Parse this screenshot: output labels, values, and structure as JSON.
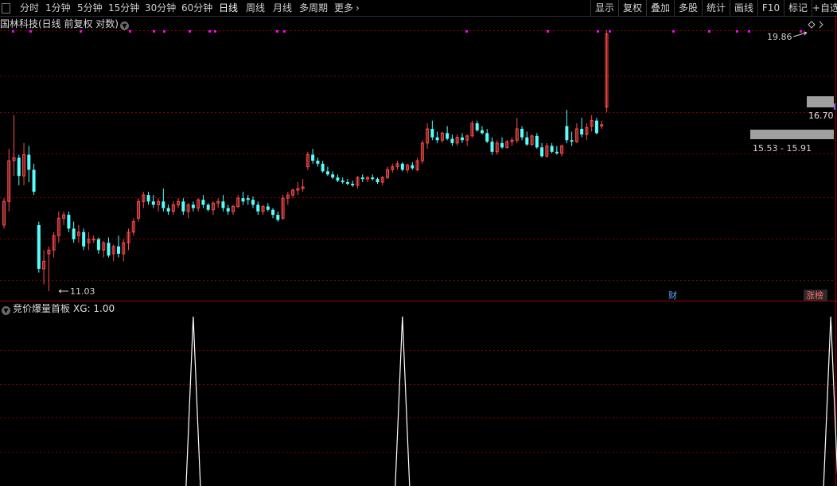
{
  "toolbar": {
    "left_buttons": [
      "分时",
      "1分钟",
      "5分钟",
      "15分钟",
      "30分钟",
      "60分钟",
      "日线",
      "周线",
      "月线",
      "多周期",
      "更多"
    ],
    "active_button": "日线",
    "right_buttons": [
      "显示",
      "复权",
      "叠加",
      "多股",
      "统计",
      "画线",
      "F10",
      "标记",
      "+自选"
    ]
  },
  "chart": {
    "title": "国林科技(日线 前复权 对数)",
    "high_label": "19.86",
    "low_label": "11.03",
    "current_price_label": "16.70",
    "range_label": "15.53 - 15.91",
    "badge_finance": "财",
    "badge_rank": "涨榜"
  },
  "indicator": {
    "title": "竞价爆量首板",
    "value_label": "XG: 1.00"
  },
  "colors": {
    "up": "#ff4a4a",
    "down": "#54ffff",
    "grid": "#8a0000",
    "marker": "#ff00ff",
    "signal": "#ffffff"
  },
  "chart_data": {
    "type": "candlestick",
    "title": "国林科技(日线 前复权 对数)",
    "y_labels": [
      "19.86",
      "16.70",
      "15.53 - 15.91",
      "11.03"
    ],
    "indicator_series": {
      "name": "XG",
      "signal_bars": [
        38,
        80,
        166
      ],
      "value": 1.0
    },
    "candles": [
      [
        12.8,
        13.6,
        12.7,
        13.5
      ],
      [
        13.5,
        15.2,
        13.2,
        14.8
      ],
      [
        14.8,
        16.4,
        14.3,
        14.9
      ],
      [
        14.9,
        15.0,
        14.0,
        14.3
      ],
      [
        14.3,
        15.4,
        14.0,
        15.0
      ],
      [
        15.0,
        15.3,
        14.1,
        14.5
      ],
      [
        14.5,
        14.7,
        13.7,
        13.8
      ],
      [
        12.8,
        12.9,
        11.5,
        11.6
      ],
      [
        11.6,
        12.1,
        11.2,
        11.8
      ],
      [
        12.0,
        12.2,
        11.03,
        12.1
      ],
      [
        12.1,
        12.6,
        11.9,
        12.5
      ],
      [
        12.5,
        13.2,
        12.3,
        13.0
      ],
      [
        13.0,
        13.2,
        12.8,
        13.1
      ],
      [
        13.1,
        13.2,
        12.6,
        12.7
      ],
      [
        12.7,
        12.9,
        12.3,
        12.4
      ],
      [
        12.5,
        12.8,
        12.3,
        12.6
      ],
      [
        12.6,
        12.7,
        12.1,
        12.2
      ],
      [
        12.3,
        12.6,
        12.1,
        12.4
      ],
      [
        12.4,
        12.5,
        12.3,
        12.4
      ],
      [
        12.4,
        12.45,
        12.0,
        12.1
      ],
      [
        12.1,
        12.35,
        11.9,
        12.3
      ],
      [
        12.3,
        12.45,
        11.9,
        11.95
      ],
      [
        12.0,
        12.25,
        11.8,
        12.2
      ],
      [
        12.2,
        12.5,
        11.9,
        12.0
      ],
      [
        12.0,
        12.4,
        11.8,
        12.3
      ],
      [
        12.3,
        12.7,
        12.1,
        12.6
      ],
      [
        12.6,
        13.0,
        12.5,
        12.9
      ],
      [
        13.0,
        13.6,
        12.9,
        13.5
      ],
      [
        13.5,
        13.8,
        13.3,
        13.7
      ],
      [
        13.7,
        13.8,
        13.4,
        13.5
      ],
      [
        13.5,
        13.7,
        13.3,
        13.4
      ],
      [
        13.4,
        13.6,
        13.2,
        13.5
      ],
      [
        13.5,
        13.9,
        13.2,
        13.3
      ],
      [
        13.3,
        13.4,
        13.1,
        13.2
      ],
      [
        13.2,
        13.5,
        13.1,
        13.4
      ],
      [
        13.4,
        13.6,
        13.3,
        13.5
      ],
      [
        13.5,
        13.6,
        13.1,
        13.2
      ],
      [
        13.2,
        13.45,
        13.0,
        13.4
      ],
      [
        13.4,
        13.5,
        13.2,
        13.3
      ],
      [
        13.3,
        13.6,
        13.2,
        13.55
      ],
      [
        13.55,
        13.7,
        13.3,
        13.4
      ],
      [
        13.4,
        13.45,
        13.2,
        13.25
      ],
      [
        13.25,
        13.5,
        13.1,
        13.45
      ],
      [
        13.45,
        13.6,
        13.3,
        13.5
      ],
      [
        13.5,
        13.7,
        13.2,
        13.3
      ],
      [
        13.3,
        13.4,
        13.1,
        13.2
      ],
      [
        13.2,
        13.4,
        13.1,
        13.35
      ],
      [
        13.35,
        13.7,
        13.3,
        13.6
      ],
      [
        13.6,
        13.8,
        13.4,
        13.5
      ],
      [
        13.6,
        13.7,
        13.4,
        13.55
      ],
      [
        13.55,
        13.65,
        13.3,
        13.4
      ],
      [
        13.4,
        13.5,
        13.1,
        13.2
      ],
      [
        13.2,
        13.4,
        13.1,
        13.35
      ],
      [
        13.35,
        13.45,
        13.2,
        13.25
      ],
      [
        13.25,
        13.3,
        13.0,
        13.1
      ],
      [
        13.1,
        13.2,
        12.9,
        12.95
      ],
      [
        13.0,
        13.7,
        12.95,
        13.6
      ],
      [
        13.6,
        13.8,
        13.4,
        13.7
      ],
      [
        13.7,
        13.9,
        13.6,
        13.85
      ],
      [
        13.85,
        14.1,
        13.7,
        13.9
      ],
      [
        13.9,
        14.2,
        13.8,
        13.95
      ],
      [
        14.6,
        15.1,
        14.5,
        15.0
      ],
      [
        15.0,
        15.2,
        14.7,
        14.8
      ],
      [
        14.8,
        14.9,
        14.6,
        14.7
      ],
      [
        14.7,
        14.8,
        14.4,
        14.45
      ],
      [
        14.45,
        14.6,
        14.3,
        14.35
      ],
      [
        14.35,
        14.45,
        14.2,
        14.25
      ],
      [
        14.25,
        14.35,
        14.1,
        14.15
      ],
      [
        14.15,
        14.25,
        14.05,
        14.1
      ],
      [
        14.1,
        14.2,
        14.0,
        14.05
      ],
      [
        14.05,
        14.15,
        13.95,
        14.0
      ],
      [
        14.0,
        14.3,
        13.9,
        14.25
      ],
      [
        14.25,
        14.35,
        14.1,
        14.2
      ],
      [
        14.2,
        14.3,
        14.1,
        14.25
      ],
      [
        14.25,
        14.35,
        14.15,
        14.2
      ],
      [
        14.2,
        14.25,
        14.05,
        14.1
      ],
      [
        14.1,
        14.3,
        14.0,
        14.25
      ],
      [
        14.25,
        14.6,
        14.2,
        14.5
      ],
      [
        14.5,
        14.7,
        14.4,
        14.6
      ],
      [
        14.6,
        14.8,
        14.5,
        14.7
      ],
      [
        14.7,
        14.75,
        14.45,
        14.5
      ],
      [
        14.5,
        14.7,
        14.4,
        14.65
      ],
      [
        14.65,
        14.75,
        14.5,
        14.55
      ],
      [
        14.5,
        14.9,
        14.45,
        14.8
      ],
      [
        14.8,
        15.5,
        14.7,
        15.4
      ],
      [
        15.4,
        16.1,
        15.2,
        15.9
      ],
      [
        15.9,
        16.2,
        15.5,
        15.6
      ],
      [
        15.6,
        15.8,
        15.4,
        15.5
      ],
      [
        15.5,
        15.8,
        15.4,
        15.75
      ],
      [
        15.75,
        16.0,
        15.5,
        15.55
      ],
      [
        15.55,
        15.7,
        15.3,
        15.4
      ],
      [
        15.4,
        15.7,
        15.3,
        15.6
      ],
      [
        15.6,
        15.75,
        15.4,
        15.5
      ],
      [
        15.5,
        15.7,
        15.3,
        15.65
      ],
      [
        15.65,
        16.2,
        15.6,
        16.1
      ],
      [
        16.1,
        16.2,
        15.8,
        15.85
      ],
      [
        15.85,
        16.0,
        15.7,
        15.75
      ],
      [
        15.75,
        15.9,
        15.4,
        15.45
      ],
      [
        15.45,
        15.6,
        15.0,
        15.1
      ],
      [
        15.1,
        15.5,
        15.0,
        15.4
      ],
      [
        15.4,
        15.6,
        15.2,
        15.25
      ],
      [
        15.25,
        15.5,
        15.2,
        15.45
      ],
      [
        15.45,
        15.6,
        15.3,
        15.5
      ],
      [
        15.5,
        16.3,
        15.4,
        15.9
      ],
      [
        15.9,
        16.0,
        15.5,
        15.6
      ],
      [
        15.6,
        15.8,
        15.3,
        15.35
      ],
      [
        15.35,
        15.7,
        15.3,
        15.65
      ],
      [
        15.65,
        15.75,
        15.2,
        15.25
      ],
      [
        15.25,
        15.4,
        14.9,
        14.95
      ],
      [
        14.95,
        15.4,
        14.9,
        15.3
      ],
      [
        15.3,
        15.4,
        15.05,
        15.1
      ],
      [
        15.1,
        15.3,
        15.0,
        15.05
      ],
      [
        15.05,
        15.35,
        14.95,
        15.3
      ],
      [
        16.0,
        16.6,
        15.4,
        15.5
      ],
      [
        15.5,
        15.8,
        15.3,
        15.45
      ],
      [
        15.45,
        16.1,
        15.4,
        15.9
      ],
      [
        15.9,
        16.3,
        15.6,
        15.7
      ],
      [
        15.7,
        16.1,
        15.5,
        15.95
      ],
      [
        16.0,
        16.4,
        15.8,
        16.2
      ],
      [
        16.2,
        16.3,
        15.7,
        15.75
      ],
      [
        16.0,
        16.2,
        15.9,
        16.05
      ],
      [
        16.7,
        19.86,
        16.5,
        19.7
      ]
    ]
  }
}
